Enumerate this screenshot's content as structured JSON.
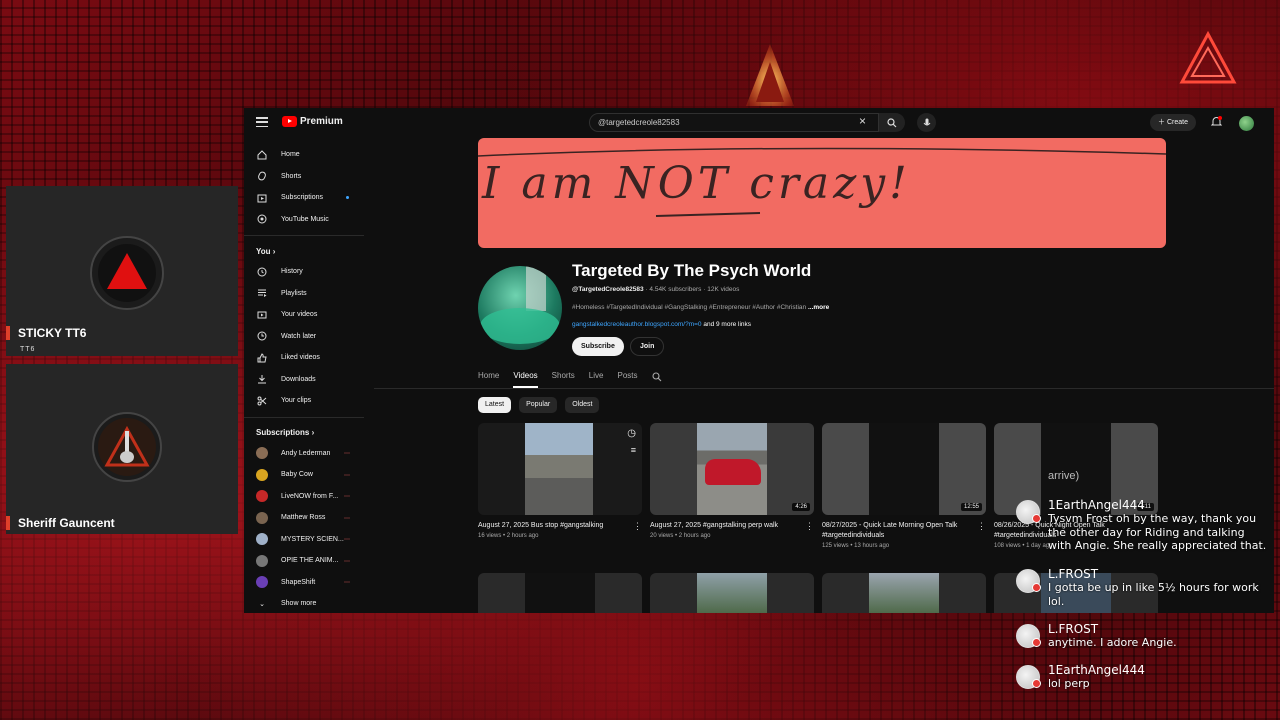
{
  "colors": {
    "accent": "#ff0000",
    "link": "#3ea6ff",
    "overlay_bar": "#e0402a"
  },
  "left_panel": {
    "cards": [
      {
        "name": "STICKY TT6",
        "subtitle": "TT6"
      },
      {
        "name": "Sheriff Gauncent"
      }
    ]
  },
  "youtube": {
    "logo_text": "Premium",
    "search": {
      "value": "@targetedcreole82583"
    },
    "create_label": "Create",
    "sidebar": {
      "main": [
        {
          "label": "Home",
          "icon": "home-icon"
        },
        {
          "label": "Shorts",
          "icon": "shorts-icon"
        },
        {
          "label": "Subscriptions",
          "icon": "subscriptions-icon"
        },
        {
          "label": "YouTube Music",
          "icon": "music-icon"
        }
      ],
      "you_heading": "You",
      "you": [
        {
          "label": "History",
          "icon": "history-icon"
        },
        {
          "label": "Playlists",
          "icon": "playlists-icon"
        },
        {
          "label": "Your videos",
          "icon": "your-videos-icon"
        },
        {
          "label": "Watch later",
          "icon": "watch-later-icon"
        },
        {
          "label": "Liked videos",
          "icon": "like-icon"
        },
        {
          "label": "Downloads",
          "icon": "download-icon"
        },
        {
          "label": "Your clips",
          "icon": "clips-icon"
        }
      ],
      "subscriptions_heading": "Subscriptions",
      "subscriptions": [
        {
          "label": "Andy Lederman",
          "color": "#8a6d55"
        },
        {
          "label": "Baby Cow",
          "color": "#d9a520"
        },
        {
          "label": "LiveNOW from F...",
          "color": "#c62828"
        },
        {
          "label": "Matthew Ross",
          "color": "#7a6450"
        },
        {
          "label": "MYSTERY SCIEN...",
          "color": "#9fb0c8"
        },
        {
          "label": "OPIE THE ANIM...",
          "color": "#777777"
        },
        {
          "label": "ShapeShift",
          "color": "#6a3fb5"
        }
      ],
      "show_more": "Show more"
    },
    "channel": {
      "banner_text": "I am NOT crazy!",
      "title": "Targeted By The Psych World",
      "handle": "@TargetedCreole82583",
      "subscribers": "4.54K subscribers",
      "videos_count": "12K videos",
      "description": "#Homeless #TargetedIndividual #GangStalking #Entrepreneur #Author #Christian",
      "description_more": "...more",
      "link": "gangstalkedcreoleauthor.blogspot.com/?m=0",
      "more_links": "and 9 more links",
      "subscribe_label": "Subscribe",
      "join_label": "Join",
      "tabs": [
        "Home",
        "Videos",
        "Shorts",
        "Live",
        "Posts"
      ],
      "active_tab": "Videos",
      "chips": [
        "Latest",
        "Popular",
        "Oldest"
      ],
      "active_chip": "Latest"
    },
    "videos": [
      {
        "title": "August 27, 2025 Bus stop #gangstalking",
        "meta": "16 views • 2 hours ago",
        "duration": ""
      },
      {
        "title": "August 27, 2025 #gangstalking perp walk",
        "meta": "20 views • 2 hours ago",
        "duration": "4:26"
      },
      {
        "title": "08/27/2025 - Quick Late Morning Open Talk #targetedindividuals",
        "meta": "125 views • 13 hours ago",
        "duration": "12:55"
      },
      {
        "title": "08/26/2025 - Quick Night Open Talk #targetedindividuals",
        "meta": "108 views • 1 day ago",
        "duration": "7:11"
      }
    ]
  },
  "chat": {
    "partial_text": "arrive)",
    "messages": [
      {
        "author": "1EarthAngel444",
        "text": "Tysvm Frost oh by the way, thank you the other day for Riding and talking with Angie. She really appreciated that."
      },
      {
        "author": "L.FROST",
        "text": "I gotta be up in like 5½ hours for work lol."
      },
      {
        "author": "L.FROST",
        "text": "anytime. I adore Angie."
      },
      {
        "author": "1EarthAngel444",
        "text": "lol perp"
      }
    ]
  }
}
